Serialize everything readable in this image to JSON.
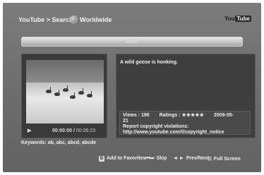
{
  "header": {
    "breadcrumb": "YouTube > Search",
    "region": "Worldwide",
    "logo_you": "You",
    "logo_tube": "Tube"
  },
  "search": {
    "query": "abcd"
  },
  "player": {
    "current_time": "00:00:00",
    "separator": "/",
    "duration": "00:06:23",
    "play_icon": "play-icon"
  },
  "keywords": "Keywords: ab, abc, abcd, abcde",
  "description": "A wild goose is honking.",
  "info": {
    "views": "Views : 196",
    "ratings": "Ratings : ★★★★★",
    "date": "2009-05-21",
    "copyright_line": "Report copyright violations:",
    "copyright_url": "http://www.youtube.com/t/copyright_notice"
  },
  "footer": {
    "add_key": "B",
    "add_label": "Add to Favorites",
    "skip_icon": "⏮⏭",
    "skip_label": "Skip",
    "prevnext_icon": "◄ ►",
    "prevnext_label": "Prev/Next",
    "fullscreen_icon": "⊡",
    "fullscreen_label": "Full Screen"
  }
}
